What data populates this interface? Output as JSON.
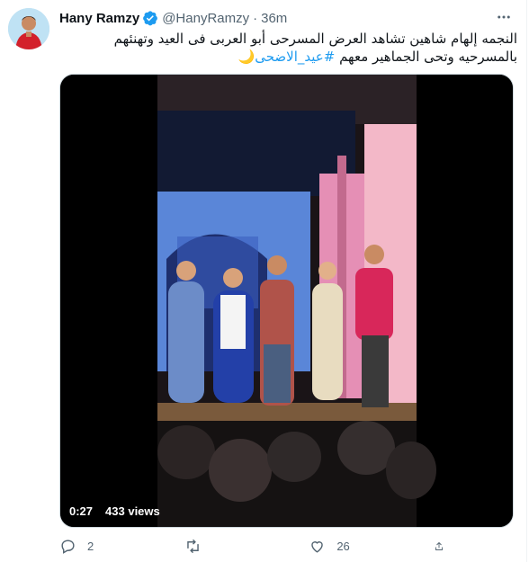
{
  "tweet": {
    "author_name": "Hany Ramzy",
    "handle": "@HanyRamzy",
    "separator": "·",
    "time": "36m",
    "text_main": "النجمه إلهام شاهين تشاهد العرض المسرحى أبو العربى فى العيد وتهنئهم بالمسرحيه وتحى الجماهير معهم",
    "hashtag": "#عيد_الاضحى",
    "emoji": "🌙"
  },
  "video": {
    "elapsed": "0:27",
    "views": "433 views"
  },
  "actions": {
    "reply_count": "2",
    "retweet_count": "",
    "like_count": "26"
  },
  "colors": {
    "accent": "#1d9bf0",
    "secondary_text": "#536471",
    "verified": "#1d9bf0"
  },
  "icons": [
    "avatar",
    "verified-badge-icon",
    "more-icon",
    "reply-icon",
    "retweet-icon",
    "like-icon",
    "share-icon"
  ]
}
